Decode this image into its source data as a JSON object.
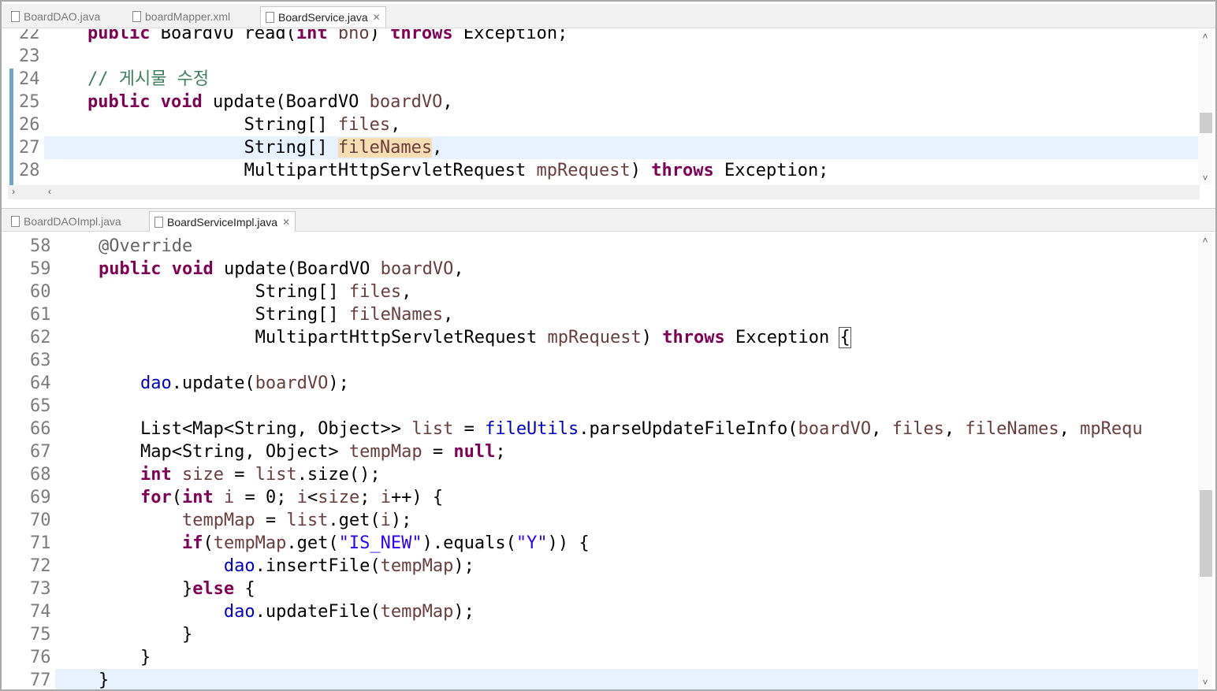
{
  "top_tabs": [
    {
      "label": "BoardDAO.java",
      "active": false,
      "icon": "java-file-icon"
    },
    {
      "label": "boardMapper.xml",
      "active": false,
      "icon": "xml-file-icon"
    },
    {
      "label": "BoardService.java",
      "active": true,
      "icon": "java-file-icon",
      "close": "✕"
    }
  ],
  "bottom_tabs": [
    {
      "label": "BoardDAOImpl.java",
      "active": false,
      "icon": "java-file-icon"
    },
    {
      "label": "BoardServiceImpl.java",
      "active": true,
      "icon": "java-file-icon",
      "close": "✕"
    }
  ],
  "top_editor": {
    "lines": [
      {
        "num": "22",
        "segments": [
          [
            "    ",
            ""
          ],
          [
            "public",
            "kw"
          ],
          [
            " BoardVO read(",
            ""
          ],
          [
            "int",
            "kw"
          ],
          [
            " ",
            ""
          ],
          [
            "bno",
            "var"
          ],
          [
            ") ",
            ""
          ],
          [
            "throws",
            "kw"
          ],
          [
            " Exception;",
            ""
          ]
        ]
      },
      {
        "num": "23",
        "segments": []
      },
      {
        "num": "24",
        "segments": [
          [
            "    ",
            ""
          ],
          [
            "// 게시물 수정",
            "cm"
          ]
        ]
      },
      {
        "num": "25",
        "segments": [
          [
            "    ",
            ""
          ],
          [
            "public",
            "kw"
          ],
          [
            " ",
            ""
          ],
          [
            "void",
            "kw"
          ],
          [
            " update(BoardVO ",
            ""
          ],
          [
            "boardVO",
            "var"
          ],
          [
            ",",
            ""
          ]
        ]
      },
      {
        "num": "26",
        "segments": [
          [
            "                   String[] ",
            ""
          ],
          [
            "files",
            "var"
          ],
          [
            ",",
            ""
          ]
        ]
      },
      {
        "num": "27",
        "segments": [
          [
            "                   String[] ",
            ""
          ],
          [
            "fileNames",
            "var occ"
          ],
          [
            ",",
            ""
          ]
        ],
        "highlight": true
      },
      {
        "num": "28",
        "segments": [
          [
            "                   MultipartHttpServletRequest ",
            ""
          ],
          [
            "mpRequest",
            "var"
          ],
          [
            ") ",
            ""
          ],
          [
            "throws",
            "kw"
          ],
          [
            " Exception;",
            ""
          ]
        ]
      }
    ]
  },
  "bottom_editor": {
    "lines": [
      {
        "num": "58",
        "segments": [
          [
            "    ",
            ""
          ],
          [
            "@Override",
            "an"
          ]
        ]
      },
      {
        "num": "59",
        "segments": [
          [
            "    ",
            ""
          ],
          [
            "public",
            "kw"
          ],
          [
            " ",
            ""
          ],
          [
            "void",
            "kw"
          ],
          [
            " update(BoardVO ",
            ""
          ],
          [
            "boardVO",
            "var"
          ],
          [
            ",",
            ""
          ]
        ]
      },
      {
        "num": "60",
        "segments": [
          [
            "                   String[] ",
            ""
          ],
          [
            "files",
            "var"
          ],
          [
            ",",
            ""
          ]
        ]
      },
      {
        "num": "61",
        "segments": [
          [
            "                   String[] ",
            ""
          ],
          [
            "fileNames",
            "var"
          ],
          [
            ",",
            ""
          ]
        ]
      },
      {
        "num": "62",
        "segments": [
          [
            "                   MultipartHttpServletRequest ",
            ""
          ],
          [
            "mpRequest",
            "var"
          ],
          [
            ") ",
            ""
          ],
          [
            "throws",
            "kw"
          ],
          [
            " Exception ",
            ""
          ],
          [
            "{",
            "bracket"
          ]
        ]
      },
      {
        "num": "63",
        "segments": []
      },
      {
        "num": "64",
        "segments": [
          [
            "        ",
            ""
          ],
          [
            "dao",
            "fld"
          ],
          [
            ".update(",
            ""
          ],
          [
            "boardVO",
            "var"
          ],
          [
            ");",
            ""
          ]
        ]
      },
      {
        "num": "65",
        "segments": []
      },
      {
        "num": "66",
        "segments": [
          [
            "        List<Map<String, Object>> ",
            ""
          ],
          [
            "list",
            "var"
          ],
          [
            " = ",
            ""
          ],
          [
            "fileUtils",
            "fld"
          ],
          [
            ".parseUpdateFileInfo(",
            ""
          ],
          [
            "boardVO",
            "var"
          ],
          [
            ", ",
            ""
          ],
          [
            "files",
            "var"
          ],
          [
            ", ",
            ""
          ],
          [
            "fileNames",
            "var"
          ],
          [
            ", ",
            ""
          ],
          [
            "mpRequ",
            "var"
          ]
        ]
      },
      {
        "num": "67",
        "segments": [
          [
            "        Map<String, Object> ",
            ""
          ],
          [
            "tempMap",
            "var"
          ],
          [
            " = ",
            ""
          ],
          [
            "null",
            "kw"
          ],
          [
            ";",
            ""
          ]
        ]
      },
      {
        "num": "68",
        "segments": [
          [
            "        ",
            ""
          ],
          [
            "int",
            "kw"
          ],
          [
            " ",
            ""
          ],
          [
            "size",
            "var"
          ],
          [
            " = ",
            ""
          ],
          [
            "list",
            "var"
          ],
          [
            ".size();",
            ""
          ]
        ]
      },
      {
        "num": "69",
        "segments": [
          [
            "        ",
            ""
          ],
          [
            "for",
            "kw"
          ],
          [
            "(",
            ""
          ],
          [
            "int",
            "kw"
          ],
          [
            " ",
            ""
          ],
          [
            "i",
            "var"
          ],
          [
            " = 0; ",
            ""
          ],
          [
            "i",
            "var"
          ],
          [
            "<",
            ""
          ],
          [
            "size",
            "var"
          ],
          [
            "; ",
            ""
          ],
          [
            "i",
            "var"
          ],
          [
            "++) {",
            ""
          ]
        ]
      },
      {
        "num": "70",
        "segments": [
          [
            "            ",
            ""
          ],
          [
            "tempMap",
            "var"
          ],
          [
            " = ",
            ""
          ],
          [
            "list",
            "var"
          ],
          [
            ".get(",
            ""
          ],
          [
            "i",
            "var"
          ],
          [
            ");",
            ""
          ]
        ]
      },
      {
        "num": "71",
        "segments": [
          [
            "            ",
            ""
          ],
          [
            "if",
            "kw"
          ],
          [
            "(",
            ""
          ],
          [
            "tempMap",
            "var"
          ],
          [
            ".get(",
            ""
          ],
          [
            "\"IS_NEW\"",
            "str"
          ],
          [
            ").equals(",
            ""
          ],
          [
            "\"Y\"",
            "str"
          ],
          [
            ")) {",
            ""
          ]
        ]
      },
      {
        "num": "72",
        "segments": [
          [
            "                ",
            ""
          ],
          [
            "dao",
            "fld"
          ],
          [
            ".insertFile(",
            ""
          ],
          [
            "tempMap",
            "var"
          ],
          [
            ");",
            ""
          ]
        ]
      },
      {
        "num": "73",
        "segments": [
          [
            "            }",
            ""
          ],
          [
            "else",
            "kw"
          ],
          [
            " {",
            ""
          ]
        ]
      },
      {
        "num": "74",
        "segments": [
          [
            "                ",
            ""
          ],
          [
            "dao",
            "fld"
          ],
          [
            ".updateFile(",
            ""
          ],
          [
            "tempMap",
            "var"
          ],
          [
            ");",
            ""
          ]
        ]
      },
      {
        "num": "75",
        "segments": [
          [
            "            }",
            ""
          ]
        ]
      },
      {
        "num": "76",
        "segments": [
          [
            "        }",
            ""
          ]
        ]
      },
      {
        "num": "77",
        "segments": [
          [
            "    }",
            ""
          ]
        ],
        "highlight": true
      }
    ]
  },
  "colors": {
    "keyword": "#7f0055",
    "comment": "#3f7f5f",
    "annotation": "#646464",
    "local_variable": "#6a3e3e",
    "field": "#0000c0",
    "string": "#2a00ff",
    "current_line": "#e8f2fe",
    "occurrence": "#f5deb3"
  },
  "scroll": {
    "up": "˄",
    "down": "˅",
    "left": "‹",
    "right": "›"
  }
}
